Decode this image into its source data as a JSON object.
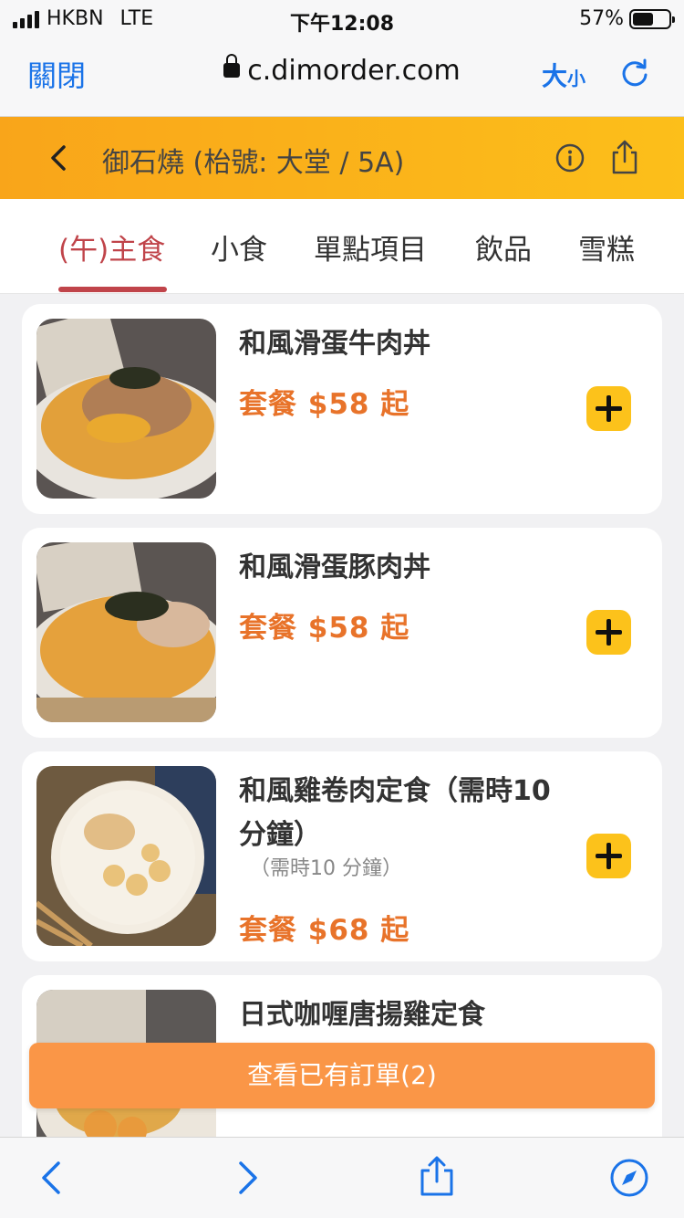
{
  "status_bar": {
    "carrier": "HKBN",
    "network": "LTE",
    "time": "下午12:08",
    "battery": "57%",
    "battery_level": 0.57
  },
  "browser": {
    "close_label": "關閉",
    "url": "c.dimorder.com",
    "text_size_big": "大",
    "text_size_small": "小"
  },
  "header": {
    "title": "御石燒 (枱號: 大堂 / 5A)"
  },
  "tabs": [
    {
      "label": "(午)主食",
      "active": true
    },
    {
      "label": "小食"
    },
    {
      "label": "單點項目"
    },
    {
      "label": "飲品"
    },
    {
      "label": "雪糕"
    }
  ],
  "menu_items": [
    {
      "name": "和風滑蛋牛肉丼",
      "price": "套餐 $58 起"
    },
    {
      "name": "和風滑蛋豚肉丼",
      "price": "套餐 $58 起"
    },
    {
      "name": "和風雞卷肉定食（需時10 分鐘）",
      "note": "（需時10 分鐘）",
      "price": "套餐 $68 起"
    },
    {
      "name": "日式咖喱唐揚雞定食"
    }
  ],
  "order_bar": {
    "label": "查看已有訂單(2)"
  },
  "colors": {
    "accent": "#c0444a",
    "price": "#e8732a",
    "header": "#fcbf1a",
    "order": "#fa9647",
    "link": "#1a73e8"
  }
}
